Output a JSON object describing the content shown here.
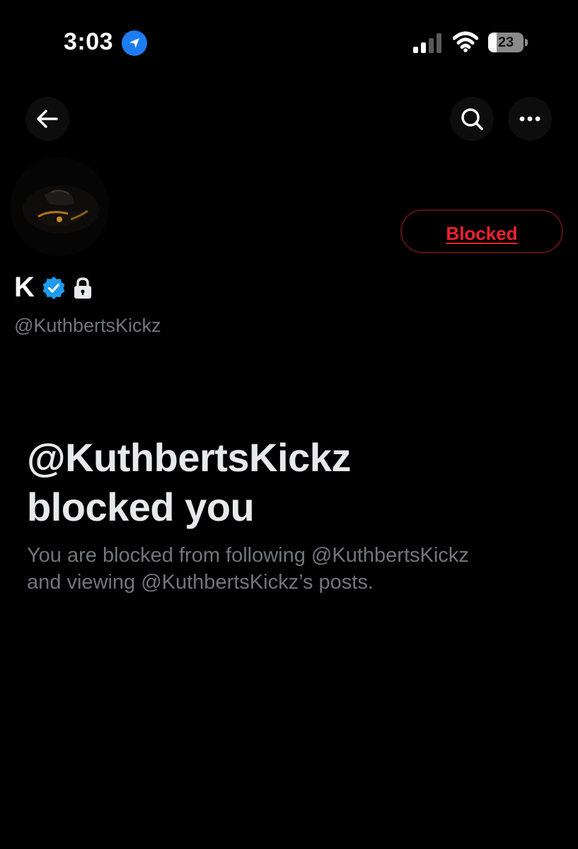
{
  "status_bar": {
    "time": "3:03",
    "battery_level": "23",
    "location_icon": "location-arrow-icon",
    "signal_icon": "cellular-signal-icon",
    "wifi_icon": "wifi-icon"
  },
  "nav": {
    "back_icon": "arrow-left-icon",
    "search_icon": "search-icon",
    "more_icon": "ellipsis-icon"
  },
  "profile": {
    "display_name": "K",
    "handle": "@KuthbertsKickz",
    "verified_icon": "verified-badge-icon",
    "protected_icon": "lock-icon",
    "follow_button_label": "Blocked"
  },
  "blocked_notice": {
    "title_line1": "@KuthbertsKickz",
    "title_line2": "blocked you",
    "description_line1": "You are blocked from following @KuthbertsKickz",
    "description_line2": "and viewing @KuthbertsKickz’s posts."
  },
  "colors": {
    "background": "#000000",
    "primary_text": "#e7e9ea",
    "secondary_text": "#71767b",
    "blocked_red": "#f4212e",
    "verified_blue": "#1d9bf0"
  }
}
